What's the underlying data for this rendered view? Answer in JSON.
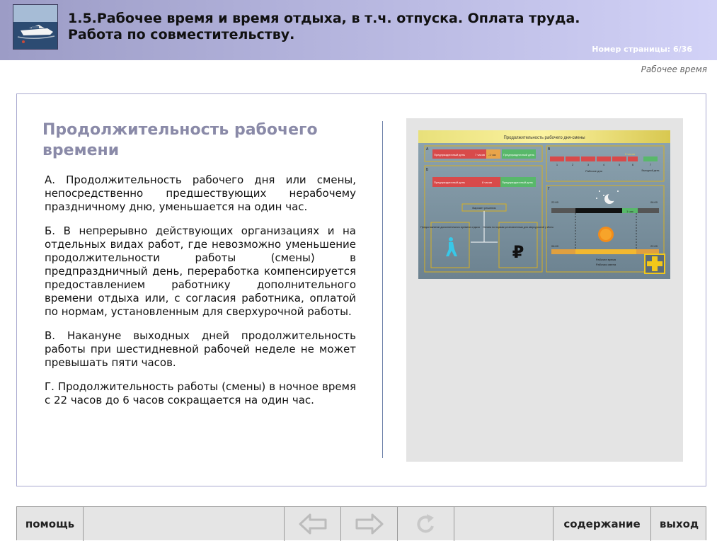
{
  "header": {
    "title_line1": "1.5.Рабочее время и время отдыха, в т.ч. отпуска. Оплата труда.",
    "title_line2": "Работа по совместительству.",
    "page_number_label": "Номер страницы:",
    "page_number_value": "6/36"
  },
  "section_label": "Рабочее время",
  "content": {
    "heading": "Продолжительность рабочего времени",
    "paragraphs": [
      "А. Продолжительность рабочего дня или смены, непосредственно предшествующих нерабочему праздничному дню, уменьшается на один час.",
      "Б. В непрерывно действующих организациях и на отдельных видах работ, где невозможно уменьшение продолжительности работы (смены) в предпраздничный день, переработка компенсируется предоставлением работнику дополнительного времени отдыха или, с согласия работника, оплатой по нормам, установленным для сверхурочной работы.",
      "В. Накануне выходных дней продолжительность работы при шестидневной рабочей неделе не может превышать пяти часов.",
      "Г. Продолжительность работы (смены) в ночное время с 22 часов до 6 часов сокращается на один час."
    ]
  },
  "diagram": {
    "title": "Продолжительность рабочего дня-смены",
    "a_label_1": "Предпраздничный день",
    "a_label_hours": "7 часов",
    "a_label_minus": "-1 час",
    "a_label_2": "Предпраздничный день",
    "b_label_1": "Предпраздничный день",
    "b_label_hours": "8 часов",
    "b_label_2": "Предпраздничный день",
    "variant_label": "Вариант решения",
    "option_rest": "Предоставление дополнительного времени отдыха",
    "option_pay": "Оплата по нормам установленным для сверхурочной работы",
    "week_days": [
      "1",
      "2",
      "3",
      "4",
      "5",
      "6",
      "7"
    ],
    "week_label": "Рабочие дни",
    "five_hours": "5 часов",
    "day_off": "Выходной день",
    "time_22": "22:00",
    "time_06": "06:00",
    "one_hour": "1 час",
    "time_06b": "06:00",
    "time_22b": "22:00",
    "working_time": "Рабочее время",
    "working_shift": "Рабочая смена",
    "ruble_sign": "₽",
    "section_a": "А",
    "section_b": "Б",
    "section_v": "В",
    "section_g": "Г"
  },
  "footer": {
    "help": "помощь",
    "contents": "содержание",
    "exit": "выход"
  },
  "colors": {
    "header_gradient_start": "#9c9cc6",
    "header_gradient_end": "#d2d2f7",
    "heading": "#8a8aa8",
    "frame_border": "#a9a9cf",
    "footer_bg": "#e5e5e5"
  }
}
